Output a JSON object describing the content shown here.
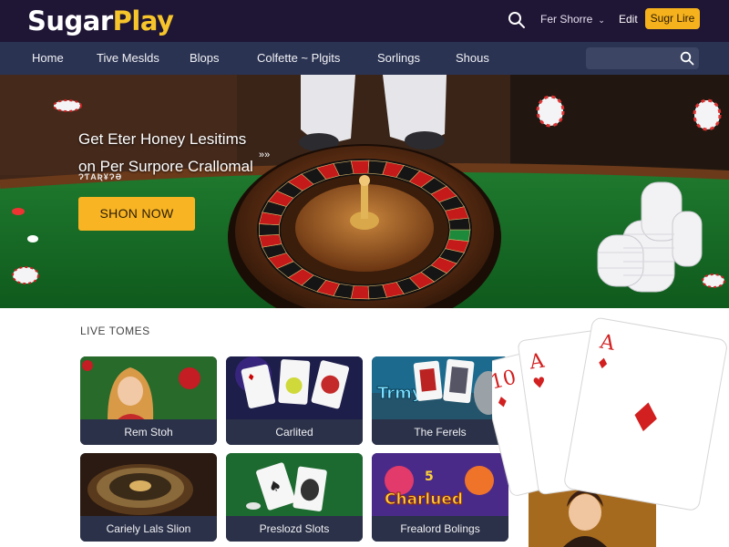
{
  "brand": {
    "logo_part1": "Sugar",
    "logo_part2": "Play",
    "accent": "#f6b21c",
    "topbar_color": "#1f1535",
    "nav_color": "#2a3352"
  },
  "topbar": {
    "search_icon": "search-icon",
    "language_label": "Fer Shorre",
    "link_label": "Edit",
    "signup_label": "Sugr Lire"
  },
  "nav": {
    "items": [
      {
        "label": "Home"
      },
      {
        "label": "Tive Meslds"
      },
      {
        "label": "Blops"
      },
      {
        "label": "Colfette ~ Plgits"
      },
      {
        "label": "Sorlings"
      },
      {
        "label": "Shous"
      }
    ],
    "search_placeholder": "",
    "search_icon": "search-icon"
  },
  "hero": {
    "title_line1": "Get Eter Honey Lesitims",
    "title_line2": "on Per Surpore Crallomal",
    "arrow": "»»",
    "subtext": "ɁƬAƦ¥ɁƏ",
    "cta_label": "SHON NOW"
  },
  "games": {
    "section_title": "LIVE TOMES",
    "cards": [
      {
        "label": "Rem Stoh"
      },
      {
        "label": "Carlited"
      },
      {
        "label": "The Ferels"
      },
      {
        "label": "Cariely Lals Slion"
      },
      {
        "label": "Preslozd Slots"
      },
      {
        "label": "Frealord Bolings"
      }
    ],
    "card3_art_text": "Trmy",
    "card6_art_text": "Charlued",
    "card6_art_number": "5"
  },
  "side_cards": {
    "rank": "A",
    "rank2": "A",
    "rank3": "10"
  }
}
